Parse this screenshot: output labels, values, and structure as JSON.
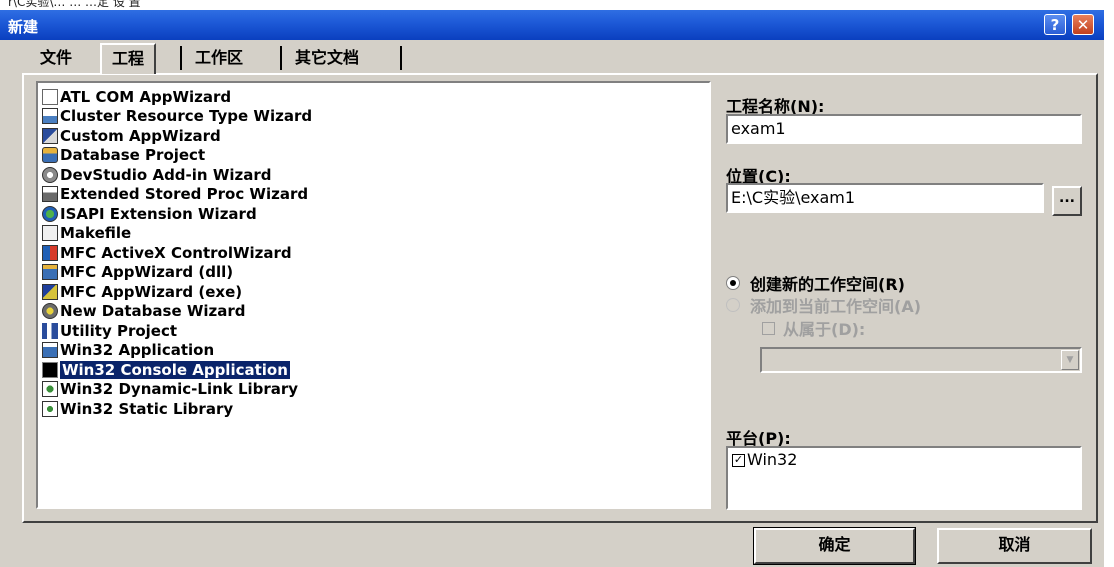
{
  "top_fragment": "r\\C实验\\…  …  …定 设 置",
  "dialog": {
    "title": "新建",
    "help_button": "?",
    "close_button": "✕"
  },
  "tabs": [
    {
      "label": "文件"
    },
    {
      "label": "工程"
    },
    {
      "label": "工作区"
    },
    {
      "label": "其它文档"
    }
  ],
  "project_types": [
    {
      "label": "ATL COM AppWizard",
      "icon": "atl-icon"
    },
    {
      "label": "Cluster Resource Type Wizard",
      "icon": "cluster-icon"
    },
    {
      "label": "Custom AppWizard",
      "icon": "custom-wizard-icon"
    },
    {
      "label": "Database Project",
      "icon": "database-icon"
    },
    {
      "label": "DevStudio Add-in Wizard",
      "icon": "addin-icon"
    },
    {
      "label": "Extended Stored Proc Wizard",
      "icon": "stored-proc-icon"
    },
    {
      "label": "ISAPI Extension Wizard",
      "icon": "isapi-icon"
    },
    {
      "label": "Makefile",
      "icon": "makefile-icon"
    },
    {
      "label": "MFC ActiveX ControlWizard",
      "icon": "activex-icon"
    },
    {
      "label": "MFC AppWizard (dll)",
      "icon": "mfc-dll-icon"
    },
    {
      "label": "MFC AppWizard (exe)",
      "icon": "mfc-exe-icon"
    },
    {
      "label": "New Database Wizard",
      "icon": "new-db-icon"
    },
    {
      "label": "Utility Project",
      "icon": "utility-icon"
    },
    {
      "label": "Win32 Application",
      "icon": "win32-app-icon"
    },
    {
      "label": "Win32 Console Application",
      "icon": "console-icon",
      "selected": true
    },
    {
      "label": "Win32 Dynamic-Link Library",
      "icon": "dll-icon"
    },
    {
      "label": "Win32 Static Library",
      "icon": "static-lib-icon"
    }
  ],
  "project_name": {
    "label": "工程名称(N):",
    "value": "exam1"
  },
  "location": {
    "label": "位置(C):",
    "value": "E:\\C实验\\exam1",
    "browse_label": "..."
  },
  "workspace": {
    "create_new": "创建新的工作空间(R)",
    "add_to_current": "添加到当前工作空间(A)",
    "dependency": "从属于(D):"
  },
  "platform": {
    "label": "平台(P):",
    "items": [
      {
        "label": "Win32",
        "checked": true
      }
    ]
  },
  "buttons": {
    "ok": "确定",
    "cancel": "取消"
  },
  "colors": {
    "title_bar": "#1c58d6",
    "selection": "#0a246a",
    "face": "#d4d0c8"
  }
}
